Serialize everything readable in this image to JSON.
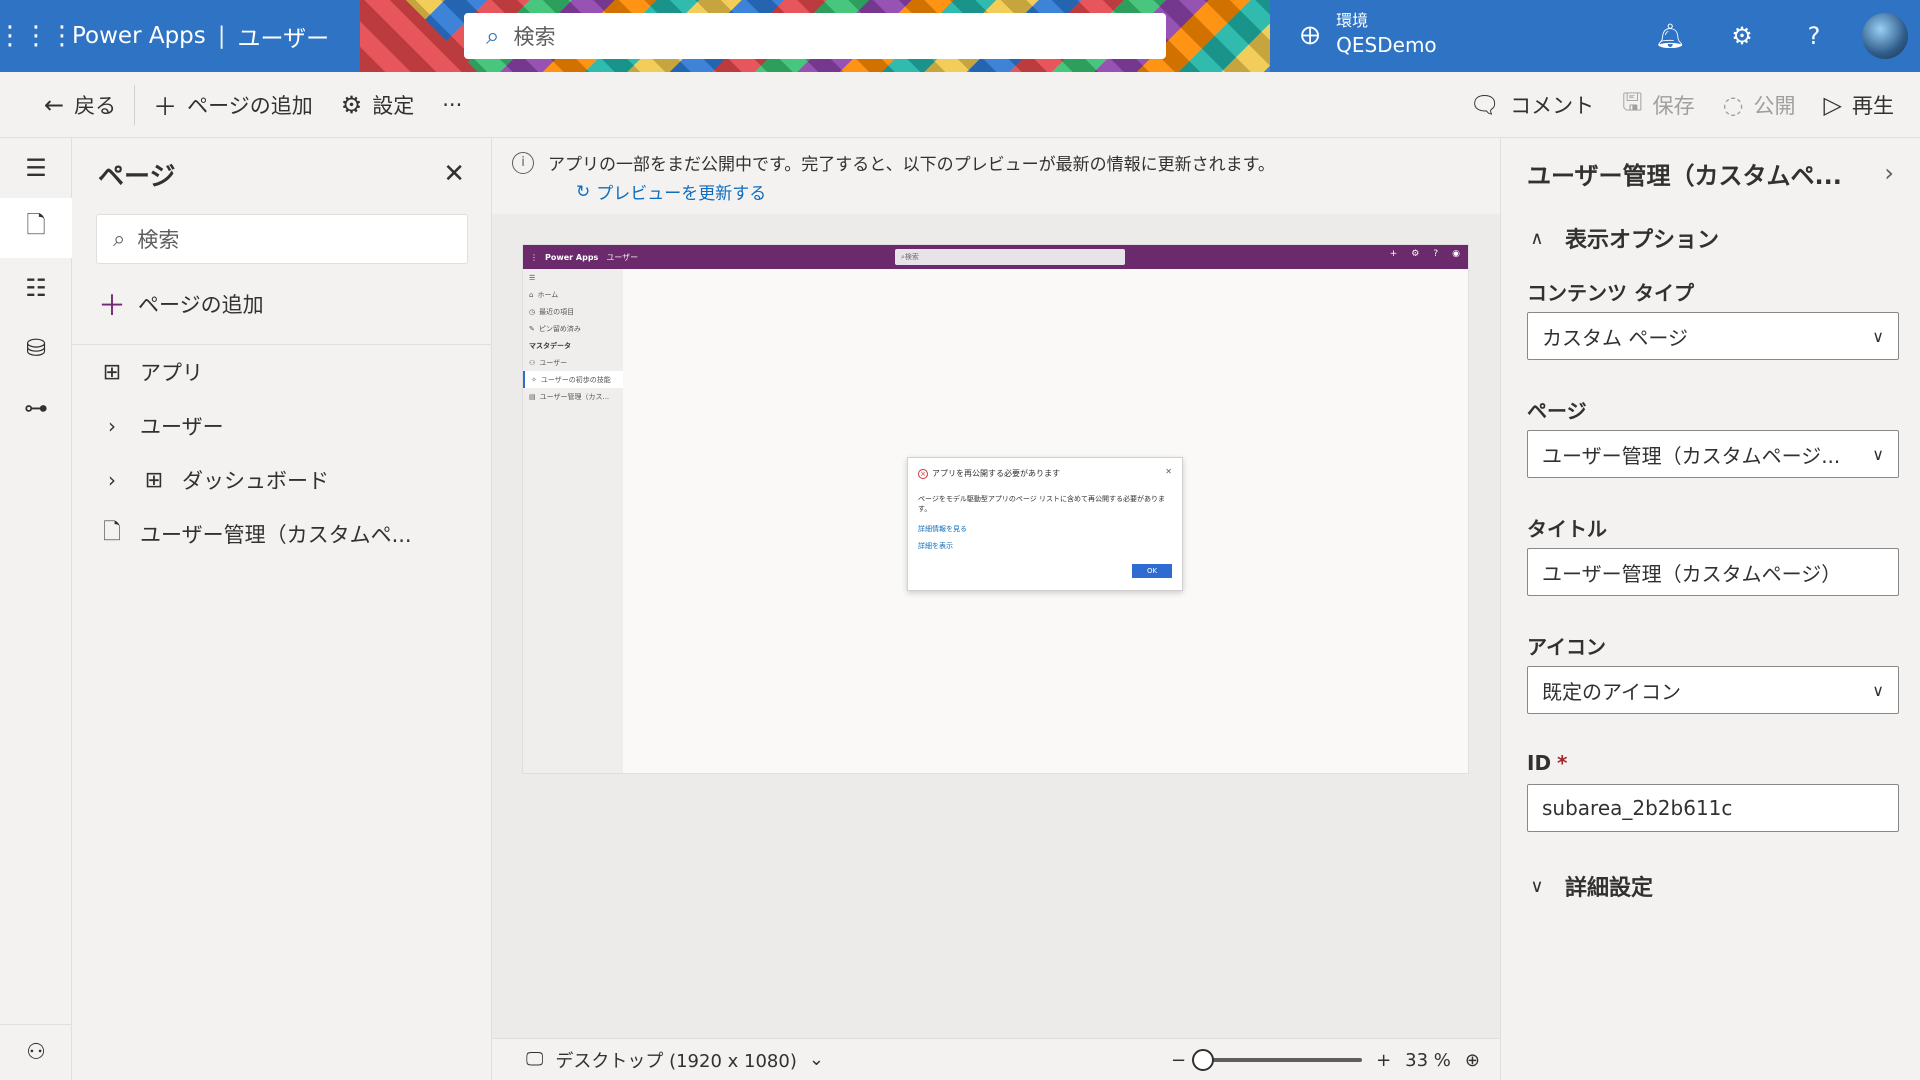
{
  "header": {
    "app_name": "Power Apps",
    "separator": "|",
    "app_context": "ユーザー",
    "search_placeholder": "検索",
    "env_label": "環境",
    "env_name": "QESDemo"
  },
  "cmdbar": {
    "back": "戻る",
    "add_page": "ページの追加",
    "settings": "設定",
    "more": "···",
    "comment": "コメント",
    "save": "保存",
    "publish": "公開",
    "play": "再生"
  },
  "pages_panel": {
    "title": "ページ",
    "search_placeholder": "検索",
    "add_page": "ページの追加",
    "items": [
      {
        "label": "アプリ"
      },
      {
        "label": "ユーザー"
      },
      {
        "label": "ダッシュボード"
      },
      {
        "label": "ユーザー管理（カスタムペ..."
      }
    ]
  },
  "notice": {
    "message": "アプリの一部をまだ公開中です。完了すると、以下のプレビューが最新の情報に更新されます。",
    "refresh_link": "プレビューを更新する"
  },
  "preview": {
    "app_name": "Power Apps",
    "app_context": "ユーザー",
    "search": "検索",
    "nav": [
      {
        "label": "ホーム"
      },
      {
        "label": "最近の項目"
      },
      {
        "label": "ピン留め済み"
      },
      {
        "label": "マスタデータ"
      },
      {
        "label": "ユーザー"
      },
      {
        "label": "ユーザーの初歩の技能"
      },
      {
        "label": "ユーザー管理（カス..."
      }
    ],
    "dialog": {
      "title": "アプリを再公開する必要があります",
      "body": "ページをモデル駆動型アプリのページ リストに含めて再公開する必要があります。",
      "link1": "詳細情報を見る",
      "link2": "詳細を表示",
      "ok": "OK"
    }
  },
  "canvas_footer": {
    "device": "デスクトップ (1920 x 1080)",
    "zoom_minus": "−",
    "zoom_plus": "+",
    "zoom_level": "33 %",
    "zoom_percent": 33
  },
  "properties": {
    "title": "ユーザー管理（カスタムペ...",
    "display_section": "表示オプション",
    "content_type_label": "コンテンツ タイプ",
    "content_type_value": "カスタム ページ",
    "page_label": "ページ",
    "page_value": "ユーザー管理（カスタムページ...",
    "title_label": "タイトル",
    "title_value": "ユーザー管理（カスタムページ）",
    "icon_label": "アイコン",
    "icon_value": "既定のアイコン",
    "id_label": "ID",
    "id_required": "*",
    "id_value": "subarea_2b2b611c",
    "advanced_section": "詳細設定"
  },
  "colors": {
    "header_bg": "#2e73c4",
    "preview_header": "#6b2a6b",
    "accent_purple": "#742774",
    "link_blue": "#0f6cbd"
  }
}
